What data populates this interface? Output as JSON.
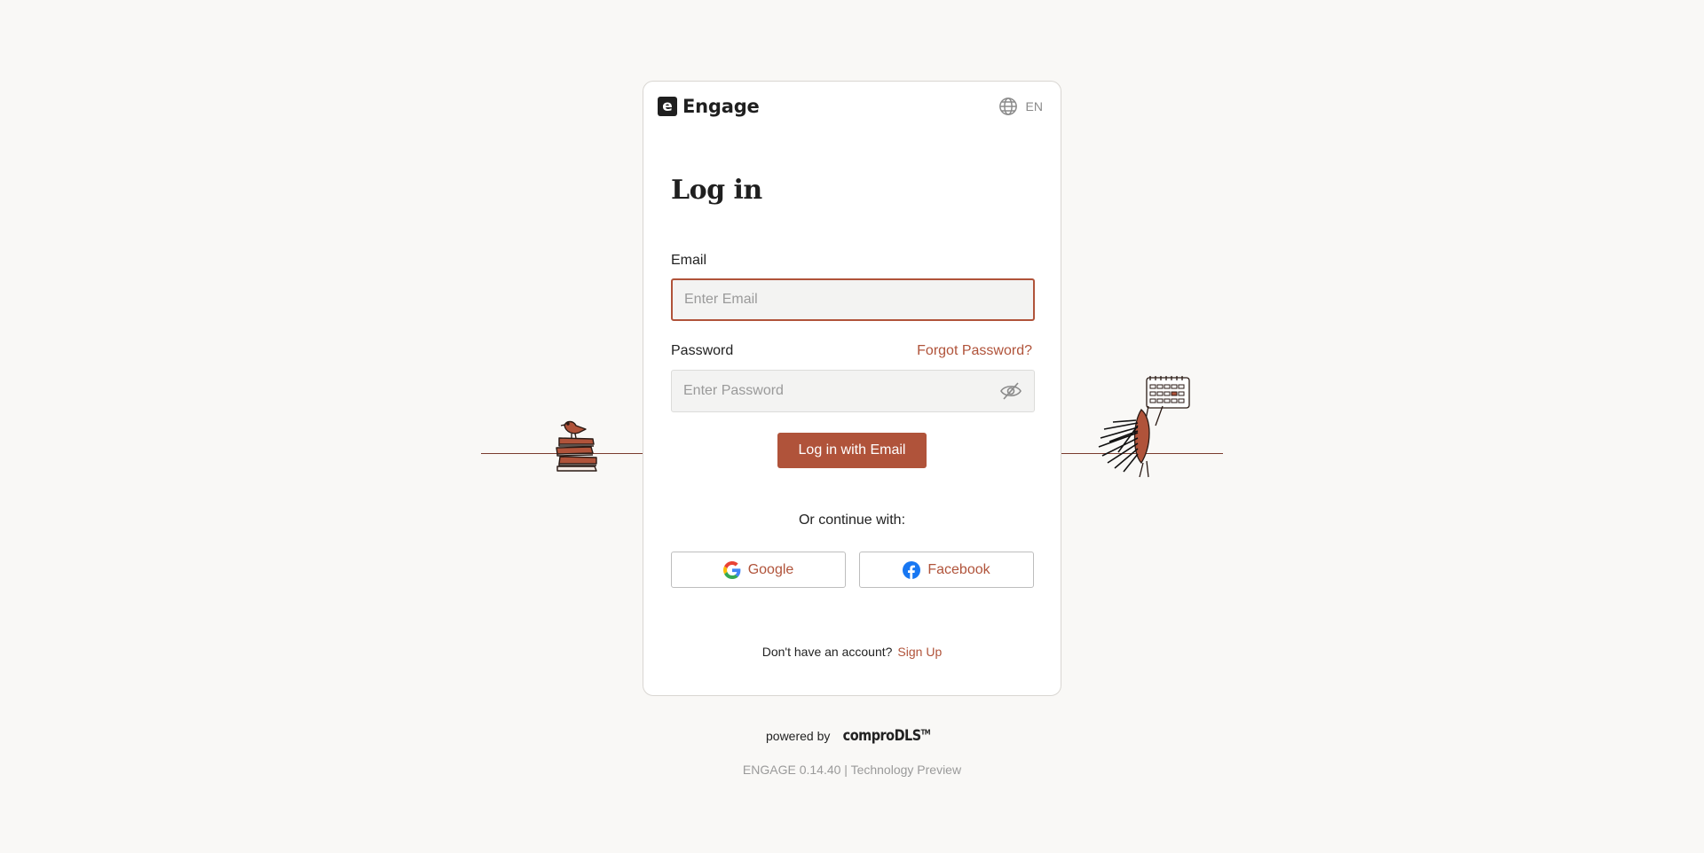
{
  "brand": {
    "logo_letter": "e",
    "name": "Engage"
  },
  "language": {
    "icon": "globe-icon",
    "code": "EN"
  },
  "login": {
    "title": "Log in",
    "email_label": "Email",
    "email_placeholder": "Enter Email",
    "email_value": "",
    "password_label": "Password",
    "password_placeholder": "Enter Password",
    "password_value": "",
    "forgot_label": "Forgot Password?",
    "submit_label": "Log in with Email",
    "or_continue": "Or continue with:",
    "google_label": "Google",
    "facebook_label": "Facebook",
    "no_account_text": "Don't have an account?",
    "signup_label": "Sign Up"
  },
  "footer": {
    "powered_by": "powered by",
    "provider": "comproDLS",
    "trademark": "TM",
    "version": "ENGAGE 0.14.40 | Technology Preview"
  },
  "colors": {
    "accent": "#b0533a",
    "background": "#f9f8f6",
    "card": "#ffffff"
  }
}
